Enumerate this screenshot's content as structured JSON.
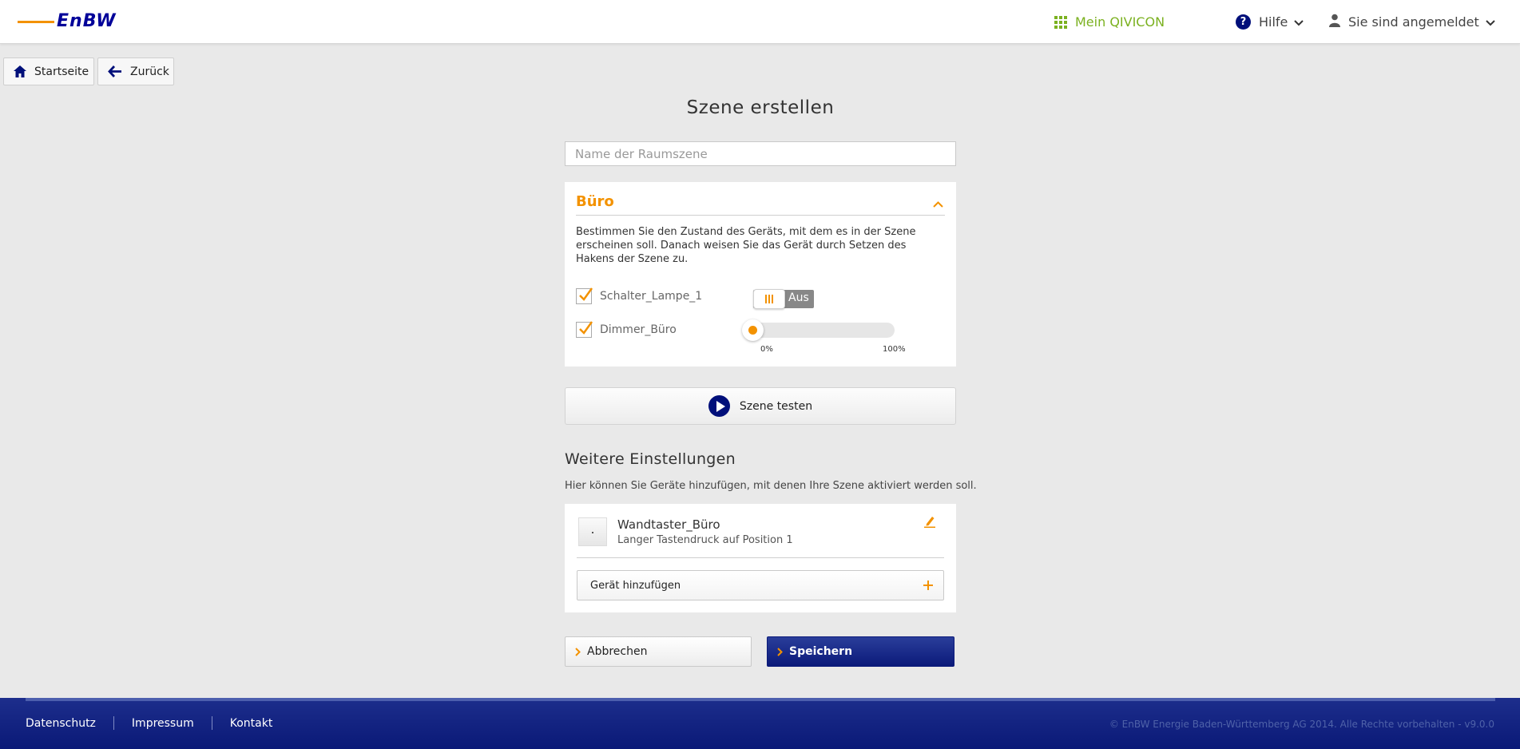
{
  "header": {
    "logo_text": "EnBW",
    "qivicon_label": "Mein QIVICON",
    "help_label": "Hilfe",
    "user_label": "Sie sind angemeldet",
    "accent_color": "#f39200",
    "brand_color": "#000f7a",
    "qivicon_color": "#7bb120"
  },
  "breadcrumb": {
    "home_label": "Startseite",
    "back_label": "Zurück"
  },
  "page": {
    "title": "Szene erstellen",
    "name_placeholder": "Name der Raumszene",
    "name_value": ""
  },
  "room": {
    "title": "Büro",
    "description": "Bestimmen Sie den Zustand des Geräts, mit dem es in der Szene erscheinen soll. Danach weisen Sie das Gerät durch Setzen des Hakens der Szene zu.",
    "devices": [
      {
        "name": "Schalter_Lampe_1",
        "checked": true,
        "control": "toggle",
        "state_label": "Aus"
      },
      {
        "name": "Dimmer_Büro",
        "checked": true,
        "control": "slider",
        "value_percent": 0,
        "min_label": "0%",
        "max_label": "100%"
      }
    ]
  },
  "test_button": {
    "label": "Szene testen"
  },
  "more_settings": {
    "title": "Weitere Einstellungen",
    "description": "Hier können Sie Geräte hinzufügen, mit denen Ihre Szene aktiviert werden soll.",
    "trigger": {
      "name": "Wandtaster_Büro",
      "detail": "Langer Tastendruck auf Position 1"
    },
    "add_device_label": "Gerät hinzufügen"
  },
  "actions": {
    "cancel_label": "Abbrechen",
    "save_label": "Speichern"
  },
  "footer": {
    "links": [
      "Datenschutz",
      "Impressum",
      "Kontakt"
    ],
    "copyright": "© EnBW Energie Baden-Württemberg AG 2014. Alle Rechte vorbehalten - v9.0.0"
  },
  "icons": {
    "home": "home-icon",
    "back": "arrow-left-icon",
    "grid": "grid-icon",
    "help": "help-icon",
    "user": "user-icon",
    "edit": "pencil-icon",
    "add": "plus-icon",
    "play": "play-icon"
  }
}
